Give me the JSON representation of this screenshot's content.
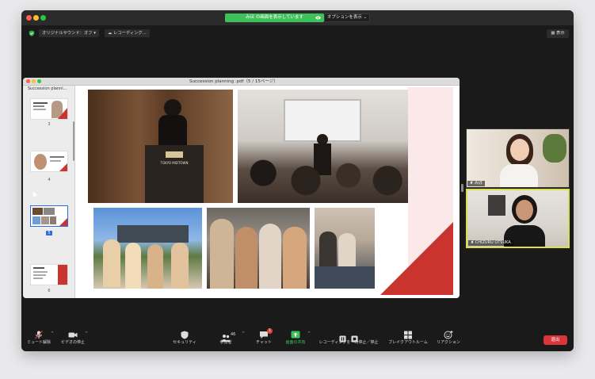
{
  "window": {
    "share_banner": "みほ の画面を表示しています",
    "options_label": "オプションを表示 ⌄"
  },
  "topbar": {
    "audio_label": "オリジナルサウンド：オフ ▾",
    "recording_label": "レコーディング...",
    "view_label": "表示"
  },
  "pdf": {
    "title": "Succession planning .pdf（5 / 15ページ）",
    "sidebar_title": "Succession planni...",
    "thumbnails": [
      {
        "number": "3"
      },
      {
        "number": "4"
      },
      {
        "number": "5"
      },
      {
        "number": "6"
      }
    ],
    "podium_text": "TOKYO MIDTOWN"
  },
  "participants": [
    {
      "name": "みほ"
    },
    {
      "name": "CHIZURU OTSUKA"
    }
  ],
  "toolbar": {
    "mute_label": "ミュート解除",
    "video_label": "ビデオの停止",
    "security_label": "セキュリティ",
    "participants_label": "参加者",
    "participants_count": "46",
    "chat_label": "チャット",
    "chat_badge": "1",
    "share_label": "画面の共有",
    "record_label": "レコーディングを一時停止／停止",
    "breakout_label": "ブレイクアウトルーム",
    "reaction_label": "リアクション",
    "end_label": "退出"
  },
  "colors": {
    "share_green": "#3ec15a",
    "active_speaker_border": "#d8e14a",
    "end_red": "#d9353a",
    "slide_accent_red": "#c9342f"
  }
}
